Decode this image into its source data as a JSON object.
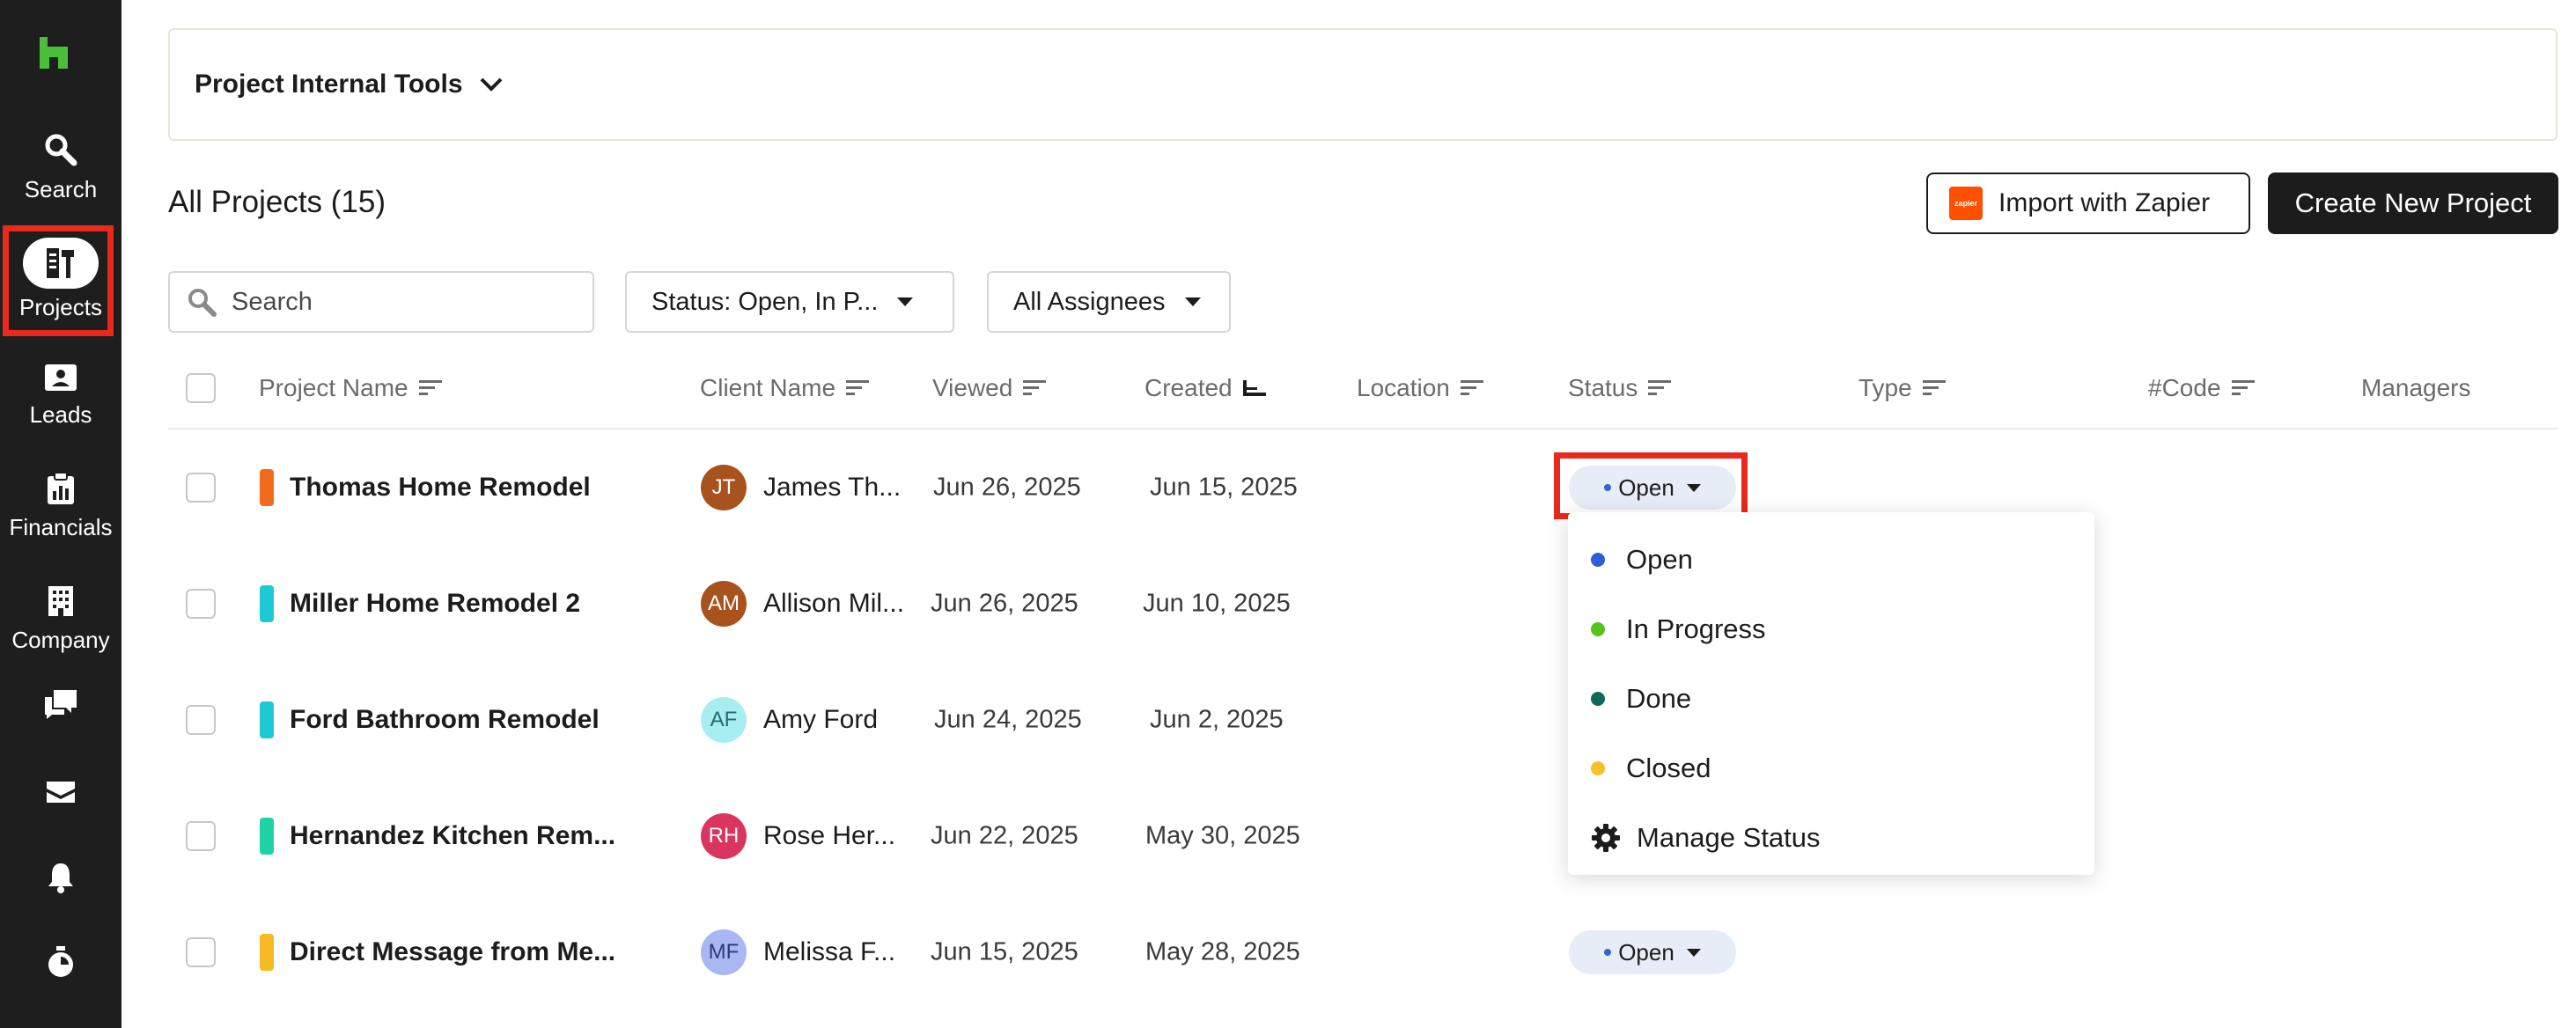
{
  "sidebar": {
    "logo": "houzz-icon",
    "items": [
      {
        "label": "Search",
        "icon": "search-icon"
      },
      {
        "label": "Projects",
        "icon": "projects-icon"
      },
      {
        "label": "Leads",
        "icon": "leads-icon"
      },
      {
        "label": "Financials",
        "icon": "financials-icon"
      },
      {
        "label": "Company",
        "icon": "company-icon"
      },
      {
        "label": "",
        "icon": "chat-icon"
      },
      {
        "label": "",
        "icon": "inbox-icon"
      },
      {
        "label": "",
        "icon": "bell-icon"
      },
      {
        "label": "",
        "icon": "timer-icon"
      }
    ]
  },
  "tools_bar": {
    "label": "Project Internal Tools"
  },
  "heading": "All Projects (15)",
  "actions": {
    "zapier_logo_text": "zapier",
    "import_label": "Import with Zapier",
    "create_label": "Create New Project"
  },
  "filters": {
    "search_placeholder": "Search",
    "status_label": "Status: Open, In P...",
    "assignees_label": "All Assignees"
  },
  "table": {
    "columns": [
      "Project Name",
      "Client Name",
      "Viewed",
      "Created",
      "Location",
      "Status",
      "Type",
      "#Code",
      "Managers"
    ],
    "rows": [
      {
        "color": "#f26b1d",
        "name": "Thomas Home Remodel",
        "initials": "JT",
        "avatar_color": "#a8521d",
        "client": "James Th...",
        "viewed": "Jun 26, 2025",
        "created": "Jun 15, 2025",
        "status": "Open"
      },
      {
        "color": "#1ec9d6",
        "name": "Miller Home Remodel 2",
        "initials": "AM",
        "avatar_color": "#a8521d",
        "client": "Allison Mil...",
        "viewed": "Jun 26, 2025",
        "created": "Jun 10, 2025",
        "status": ""
      },
      {
        "color": "#1ec9d6",
        "name": "Ford Bathroom Remodel",
        "initials": "AF",
        "avatar_color": "#a6eef0",
        "client": "Amy Ford",
        "viewed": "Jun 24, 2025",
        "created": "Jun 2, 2025",
        "status": ""
      },
      {
        "color": "#1fd3a4",
        "name": "Hernandez Kitchen Rem...",
        "initials": "RH",
        "avatar_color": "#d8365e",
        "client": "Rose Her...",
        "viewed": "Jun 22, 2025",
        "created": "May 30, 2025",
        "status": ""
      },
      {
        "color": "#f7b924",
        "name": "Direct Message from Me...",
        "initials": "MF",
        "avatar_color": "#a9b8f2",
        "client": "Melissa F...",
        "viewed": "Jun 15, 2025",
        "created": "May 28, 2025",
        "status": "Open"
      }
    ]
  },
  "status_dropdown": {
    "options": [
      {
        "label": "Open",
        "color": "#2f5fd6"
      },
      {
        "label": "In Progress",
        "color": "#52c41a"
      },
      {
        "label": "Done",
        "color": "#0e6b5a"
      },
      {
        "label": "Closed",
        "color": "#f5c02a"
      }
    ],
    "manage_label": "Manage Status"
  },
  "colors": {
    "sidebar_bg": "#1e1e1e",
    "highlight": "#e8291c",
    "status_pill_bg": "#e6edf7"
  }
}
